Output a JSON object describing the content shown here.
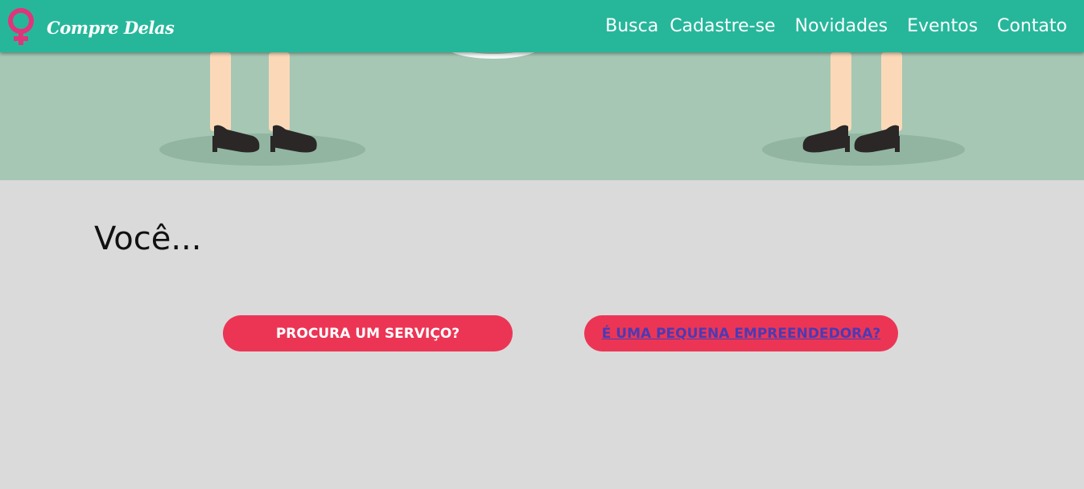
{
  "header": {
    "brand": "Compre Delas",
    "nav": [
      "Busca",
      "Cadastre-se",
      "Novidades",
      "Eventos",
      "Contato"
    ]
  },
  "main": {
    "heading": "Você...",
    "buttons": [
      "PROCURA UM SERVIÇO?",
      "É UMA PEQUENA EMPREENDEDORA?"
    ]
  },
  "icons": {
    "logo": "female-symbol-icon"
  },
  "colors": {
    "header_bg": "#26b79b",
    "hero_bg": "#a5c7b4",
    "content_bg": "#dadada",
    "button_bg": "#ec3555",
    "logo_pink": "#e0357a"
  }
}
